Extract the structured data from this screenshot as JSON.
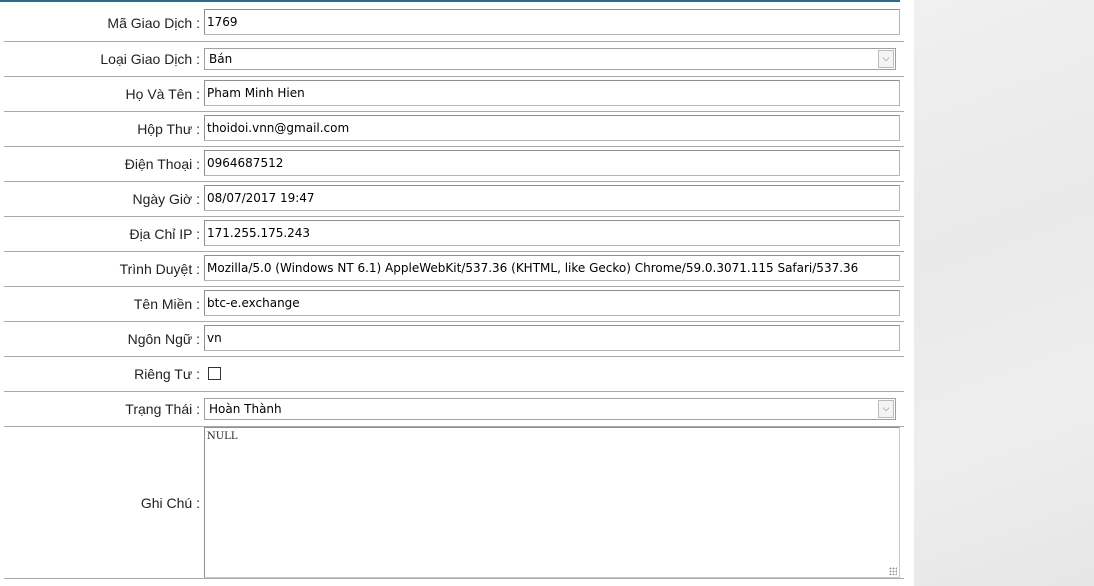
{
  "form": {
    "rows": [
      {
        "label": "Mã Giao Dịch :",
        "value": "1769"
      },
      {
        "label": "Loại Giao Dịch :",
        "value": "Bán"
      },
      {
        "label": "Họ Và Tên :",
        "value": "Pham Minh Hien"
      },
      {
        "label": "Hộp Thư :",
        "value": "thoidoi.vnn@gmail.com"
      },
      {
        "label": "Điện Thoại :",
        "value": "0964687512"
      },
      {
        "label": "Ngày Giờ :",
        "value": "08/07/2017 19:47"
      },
      {
        "label": "Địa Chỉ IP :",
        "value": "171.255.175.243"
      },
      {
        "label": "Trình Duyệt :",
        "value": "Mozilla/5.0 (Windows NT 6.1) AppleWebKit/537.36 (KHTML, like Gecko) Chrome/59.0.3071.115 Safari/537.36"
      },
      {
        "label": "Tên Miền :",
        "value": "btc-e.exchange"
      },
      {
        "label": "Ngôn Ngữ :",
        "value": "vn"
      },
      {
        "label": "Riêng Tư :",
        "value": ""
      },
      {
        "label": "Trạng Thái :",
        "value": "Hoàn Thành"
      },
      {
        "label": "Ghi Chú :",
        "value": "NULL"
      }
    ],
    "private_checked": false,
    "dropdown_icon": "chevron-down-icon"
  }
}
